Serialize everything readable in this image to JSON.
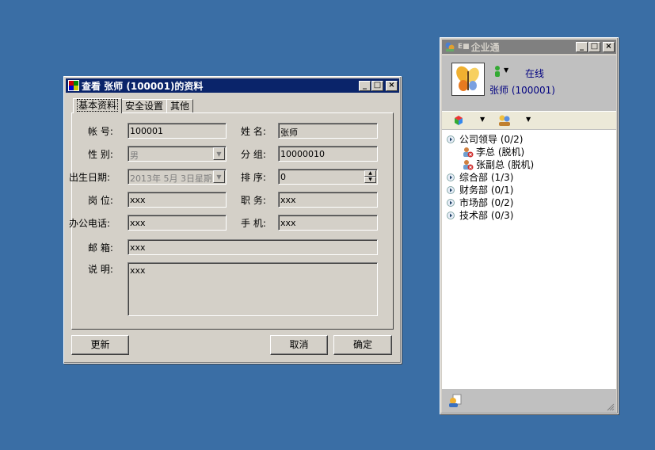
{
  "profile_dialog": {
    "title": "查看 张师 (100001)的资料",
    "tabs": [
      "基本资料",
      "安全设置",
      "其他"
    ],
    "fields": {
      "account": {
        "label": "帐  号:",
        "value": "100001"
      },
      "name": {
        "label": "姓  名:",
        "value": "张师"
      },
      "gender": {
        "label": "性  别:",
        "value": "男"
      },
      "group": {
        "label": "分  组:",
        "value": "10000010"
      },
      "birthday": {
        "label": "出生日期:",
        "value": "2013年  5月  3日星期"
      },
      "order": {
        "label": "排  序:",
        "value": "0"
      },
      "post": {
        "label": "岗  位:",
        "value": "xxx"
      },
      "duty": {
        "label": "职  务:",
        "value": "xxx"
      },
      "office_phone": {
        "label": "办公电话:",
        "value": "xxx"
      },
      "mobile": {
        "label": "手  机:",
        "value": "xxx"
      },
      "email": {
        "label": "邮  箱:",
        "value": "xxx"
      },
      "note": {
        "label": "说  明:",
        "value": "xxx"
      }
    },
    "buttons": {
      "update": "更新",
      "cancel": "取消",
      "ok": "确定"
    }
  },
  "im_window": {
    "title": "企业通",
    "status": "在线",
    "user": "张师 (100001)",
    "tree": [
      {
        "label": "公司领导 (0/2)",
        "type": "group"
      },
      {
        "label": "李总 (脱机)",
        "type": "user"
      },
      {
        "label": "张副总 (脱机)",
        "type": "user"
      },
      {
        "label": "综合部 (1/3)",
        "type": "group"
      },
      {
        "label": "财务部 (0/1)",
        "type": "group"
      },
      {
        "label": "市场部 (0/2)",
        "type": "group"
      },
      {
        "label": "技术部 (0/3)",
        "type": "group"
      }
    ]
  },
  "colors": {
    "desktop": "#3a6ea5",
    "active_title": "#0a246a",
    "inactive_title": "#808080",
    "link": "#000080"
  }
}
